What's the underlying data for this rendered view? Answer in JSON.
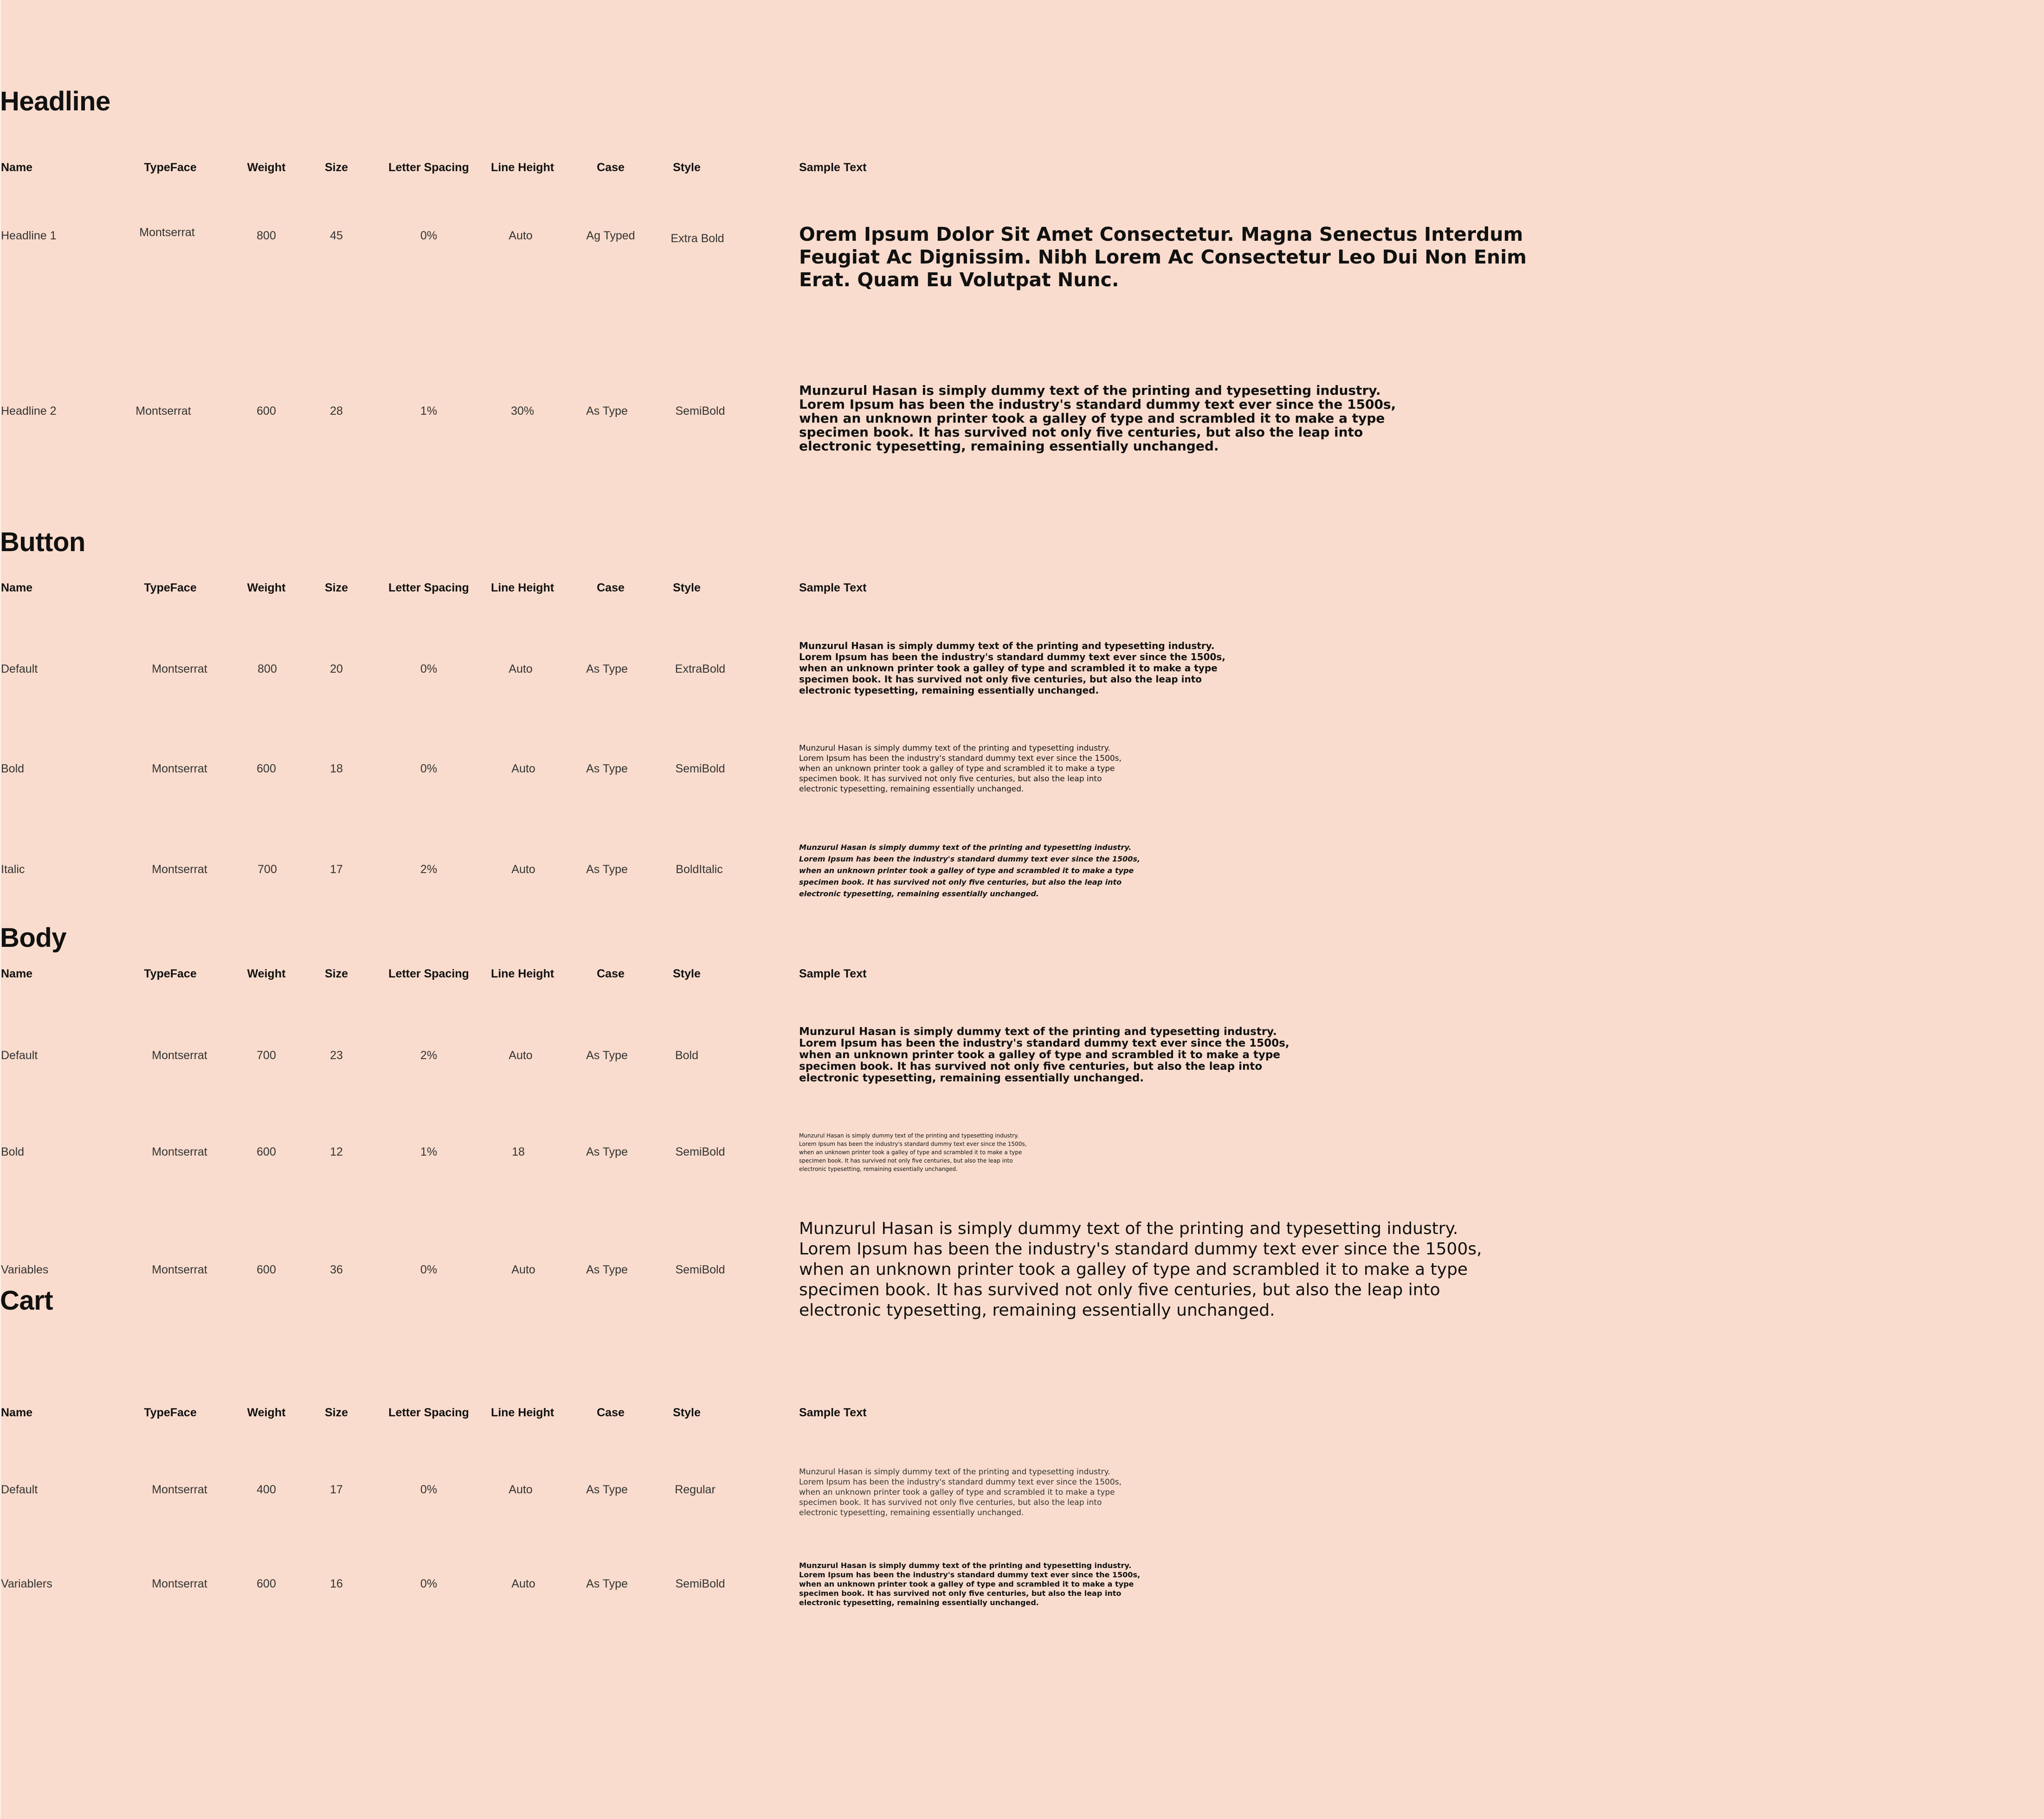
{
  "columns": {
    "name": "Name",
    "typeface": "TypeFace",
    "weight": "Weight",
    "size": "Size",
    "letter_spacing": "Letter Spacing",
    "line_height": "Line Height",
    "case": "Case",
    "style": "Style",
    "sample": "Sample Text"
  },
  "sections": {
    "headline": {
      "title": "Headline",
      "rows": [
        {
          "name": "Headline 1",
          "typeface": "Montserrat",
          "weight": "800",
          "size": "45",
          "letter_spacing": "0%",
          "line_height": "Auto",
          "case": "Ag Typed",
          "style": "Extra Bold",
          "sample": "Orem Ipsum Dolor Sit Amet Consectetur. Magna Senectus Interdum Feugiat Ac Dignissim. Nibh Lorem Ac Consectetur Leo Dui Non Enim Erat. Quam Eu Volutpat Nunc."
        },
        {
          "name": "Headline 2",
          "typeface": "Montserrat",
          "weight": "600",
          "size": "28",
          "letter_spacing": "1%",
          "line_height": "30%",
          "case": "As Type",
          "style": "SemiBold",
          "sample": "Munzurul Hasan is simply dummy text of the printing and typesetting industry.\nLorem Ipsum has been the industry's standard dummy text ever since the 1500s,\nwhen an unknown printer took a galley of type and scrambled it to make a type\nspecimen book. It has survived not only five centuries, but also the leap into\nelectronic typesetting, remaining essentially unchanged."
        }
      ]
    },
    "button": {
      "title": "Button",
      "rows": [
        {
          "name": "Default",
          "typeface": "Montserrat",
          "weight": "800",
          "size": "20",
          "letter_spacing": "0%",
          "line_height": "Auto",
          "case": "As Type",
          "style": "ExtraBold",
          "sample": "Munzurul Hasan is simply dummy text of the printing and typesetting industry.\nLorem Ipsum has been the industry's standard dummy text ever since the 1500s,\nwhen an unknown printer took a galley of type and scrambled it to make a type\nspecimen book. It has survived not only five centuries, but also the leap into\nelectronic typesetting, remaining essentially unchanged."
        },
        {
          "name": "Bold",
          "typeface": "Montserrat",
          "weight": "600",
          "size": "18",
          "letter_spacing": "0%",
          "line_height": "Auto",
          "case": "As Type",
          "style": "SemiBold",
          "sample": "Munzurul Hasan is simply dummy text of the printing and typesetting industry.\nLorem Ipsum has been the industry's standard dummy text ever since the 1500s,\nwhen an unknown printer took a galley of type and scrambled it to make a type\nspecimen book. It has survived not only five centuries, but also the leap into\nelectronic typesetting, remaining essentially unchanged."
        },
        {
          "name": "Italic",
          "typeface": "Montserrat",
          "weight": "700",
          "size": "17",
          "letter_spacing": "2%",
          "line_height": "Auto",
          "case": "As Type",
          "style": "BoldItalic",
          "sample": "Munzurul Hasan is simply dummy text of the printing and typesetting industry.\nLorem Ipsum has been the industry's standard dummy text ever since the 1500s,\nwhen an unknown printer took a galley of type and scrambled it to make a type\nspecimen book. It has survived not only five centuries, but also the leap into\nelectronic typesetting, remaining essentially unchanged."
        }
      ]
    },
    "body": {
      "title": "Body",
      "rows": [
        {
          "name": "Default",
          "typeface": "Montserrat",
          "weight": "700",
          "size": "23",
          "letter_spacing": "2%",
          "line_height": "Auto",
          "case": "As Type",
          "style": "Bold",
          "sample": "Munzurul Hasan is simply dummy text of the printing and typesetting industry.\nLorem Ipsum has been the industry's standard dummy text ever since the 1500s,\nwhen an unknown printer took a galley of type and scrambled it to make a type\nspecimen book. It has survived not only five centuries, but also the leap into\nelectronic typesetting, remaining essentially unchanged."
        },
        {
          "name": "Bold",
          "typeface": "Montserrat",
          "weight": "600",
          "size": "12",
          "letter_spacing": "1%",
          "line_height": "18",
          "case": "As Type",
          "style": "SemiBold",
          "sample": "Munzurul Hasan is simply dummy text of the printing and typesetting industry.\nLorem Ipsum has been the industry's standard dummy text ever since the 1500s,\nwhen an unknown printer took a galley of type and scrambled it to make a type\nspecimen book. It has survived not only five centuries, but also the leap into\nelectronic typesetting, remaining essentially unchanged."
        },
        {
          "name": "Variables",
          "typeface": "Montserrat",
          "weight": "600",
          "size": "36",
          "letter_spacing": "0%",
          "line_height": "Auto",
          "case": "As Type",
          "style": "SemiBold",
          "sample": "Munzurul Hasan is simply dummy text of the printing and typesetting industry.\nLorem Ipsum has been the industry's standard dummy text ever since the 1500s,\nwhen an unknown printer took a galley of type and scrambled it to make a type\nspecimen book. It has survived not only five centuries, but also the leap into\nelectronic typesetting, remaining essentially unchanged."
        }
      ]
    },
    "cart": {
      "title": "Cart",
      "rows": [
        {
          "name": "Default",
          "typeface": "Montserrat",
          "weight": "400",
          "size": "17",
          "letter_spacing": "0%",
          "line_height": "Auto",
          "case": "As Type",
          "style": "Regular",
          "sample": "Munzurul Hasan is simply dummy text of the printing and typesetting industry.\nLorem Ipsum has been the industry's standard dummy text ever since the 1500s,\nwhen an unknown printer took a galley of type and scrambled it to make a type\nspecimen book. It has survived not only five centuries, but also the leap into\nelectronic typesetting, remaining essentially unchanged."
        },
        {
          "name": "Variablers",
          "typeface": "Montserrat",
          "weight": "600",
          "size": "16",
          "letter_spacing": "0%",
          "line_height": "Auto",
          "case": "As Type",
          "style": "SemiBold",
          "sample": "Munzurul Hasan is simply dummy text of the printing and typesetting industry.\nLorem Ipsum has been the industry's standard dummy text ever since the 1500s,\nwhen an unknown printer took a galley of type and scrambled it to make a type\nspecimen book. It has survived not only five centuries, but also the leap into\nelectronic typesetting, remaining essentially unchanged."
        }
      ]
    }
  },
  "colors": {
    "background": "#f9dccd",
    "text": "#111111"
  }
}
